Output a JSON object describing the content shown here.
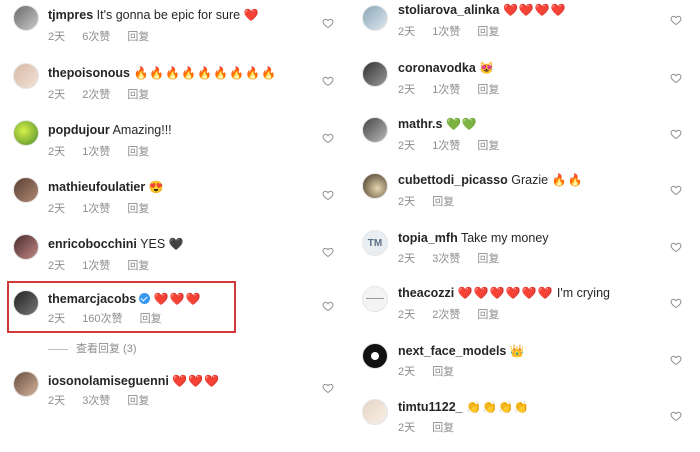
{
  "left_comments": [
    {
      "username": "tjmpres",
      "text": "It's gonna be epic for sure",
      "emoji": "❤️",
      "time": "2天",
      "likes": "6次赞",
      "reply": "回复"
    },
    {
      "username": "thepoisonous",
      "text": "",
      "emoji": "🔥🔥🔥🔥🔥🔥🔥🔥🔥",
      "time": "2天",
      "likes": "2次赞",
      "reply": "回复"
    },
    {
      "username": "popdujour",
      "text": "Amazing!!!",
      "emoji": "",
      "time": "2天",
      "likes": "1次赞",
      "reply": "回复"
    },
    {
      "username": "mathieufoulatier",
      "text": "",
      "emoji": "😍",
      "time": "2天",
      "likes": "1次赞",
      "reply": "回复"
    },
    {
      "username": "enricobocchini",
      "text": "YES",
      "emoji": "🖤",
      "time": "2天",
      "likes": "1次赞",
      "reply": "回复"
    },
    {
      "username": "themarcjacobs",
      "text": "",
      "emoji": "❤️❤️❤️",
      "time": "2天",
      "likes": "160次赞",
      "reply": "回复",
      "verified": true
    },
    {
      "username": "iosonolamiseguenni",
      "text": "",
      "emoji": "❤️❤️❤️",
      "time": "2天",
      "likes": "3次赞",
      "reply": "回复"
    }
  ],
  "view_replies": "查看回复 (3)",
  "right_comments": [
    {
      "username": "stoliarova_alinka",
      "text": "",
      "emoji": "❤️❤️❤️❤️",
      "time": "2天",
      "likes": "1次赞",
      "reply": "回复"
    },
    {
      "username": "coronavodka",
      "text": "",
      "emoji": "😻",
      "time": "2天",
      "likes": "1次赞",
      "reply": "回复"
    },
    {
      "username": "mathr.s",
      "text": "",
      "emoji": "💚💚",
      "time": "2天",
      "likes": "1次赞",
      "reply": "回复"
    },
    {
      "username": "cubettodi_picasso",
      "text": "Grazie",
      "emoji": "🔥🔥",
      "time": "2天",
      "likes": "",
      "reply": "回复"
    },
    {
      "username": "topia_mfh",
      "text": "Take my money",
      "emoji": "",
      "time": "2天",
      "likes": "3次赞",
      "reply": "回复",
      "avatar_text": "TM"
    },
    {
      "username": "theacozzi",
      "text": "I'm crying",
      "emoji": "❤️❤️❤️❤️❤️❤️",
      "time": "2天",
      "likes": "2次赞",
      "reply": "回复"
    },
    {
      "username": "next_face_models",
      "text": "",
      "emoji": "👑",
      "time": "2天",
      "likes": "",
      "reply": "回复"
    },
    {
      "username": "timtu1122_",
      "text": "",
      "emoji": "👏👏👏👏",
      "time": "2天",
      "likes": "",
      "reply": "回复"
    }
  ]
}
